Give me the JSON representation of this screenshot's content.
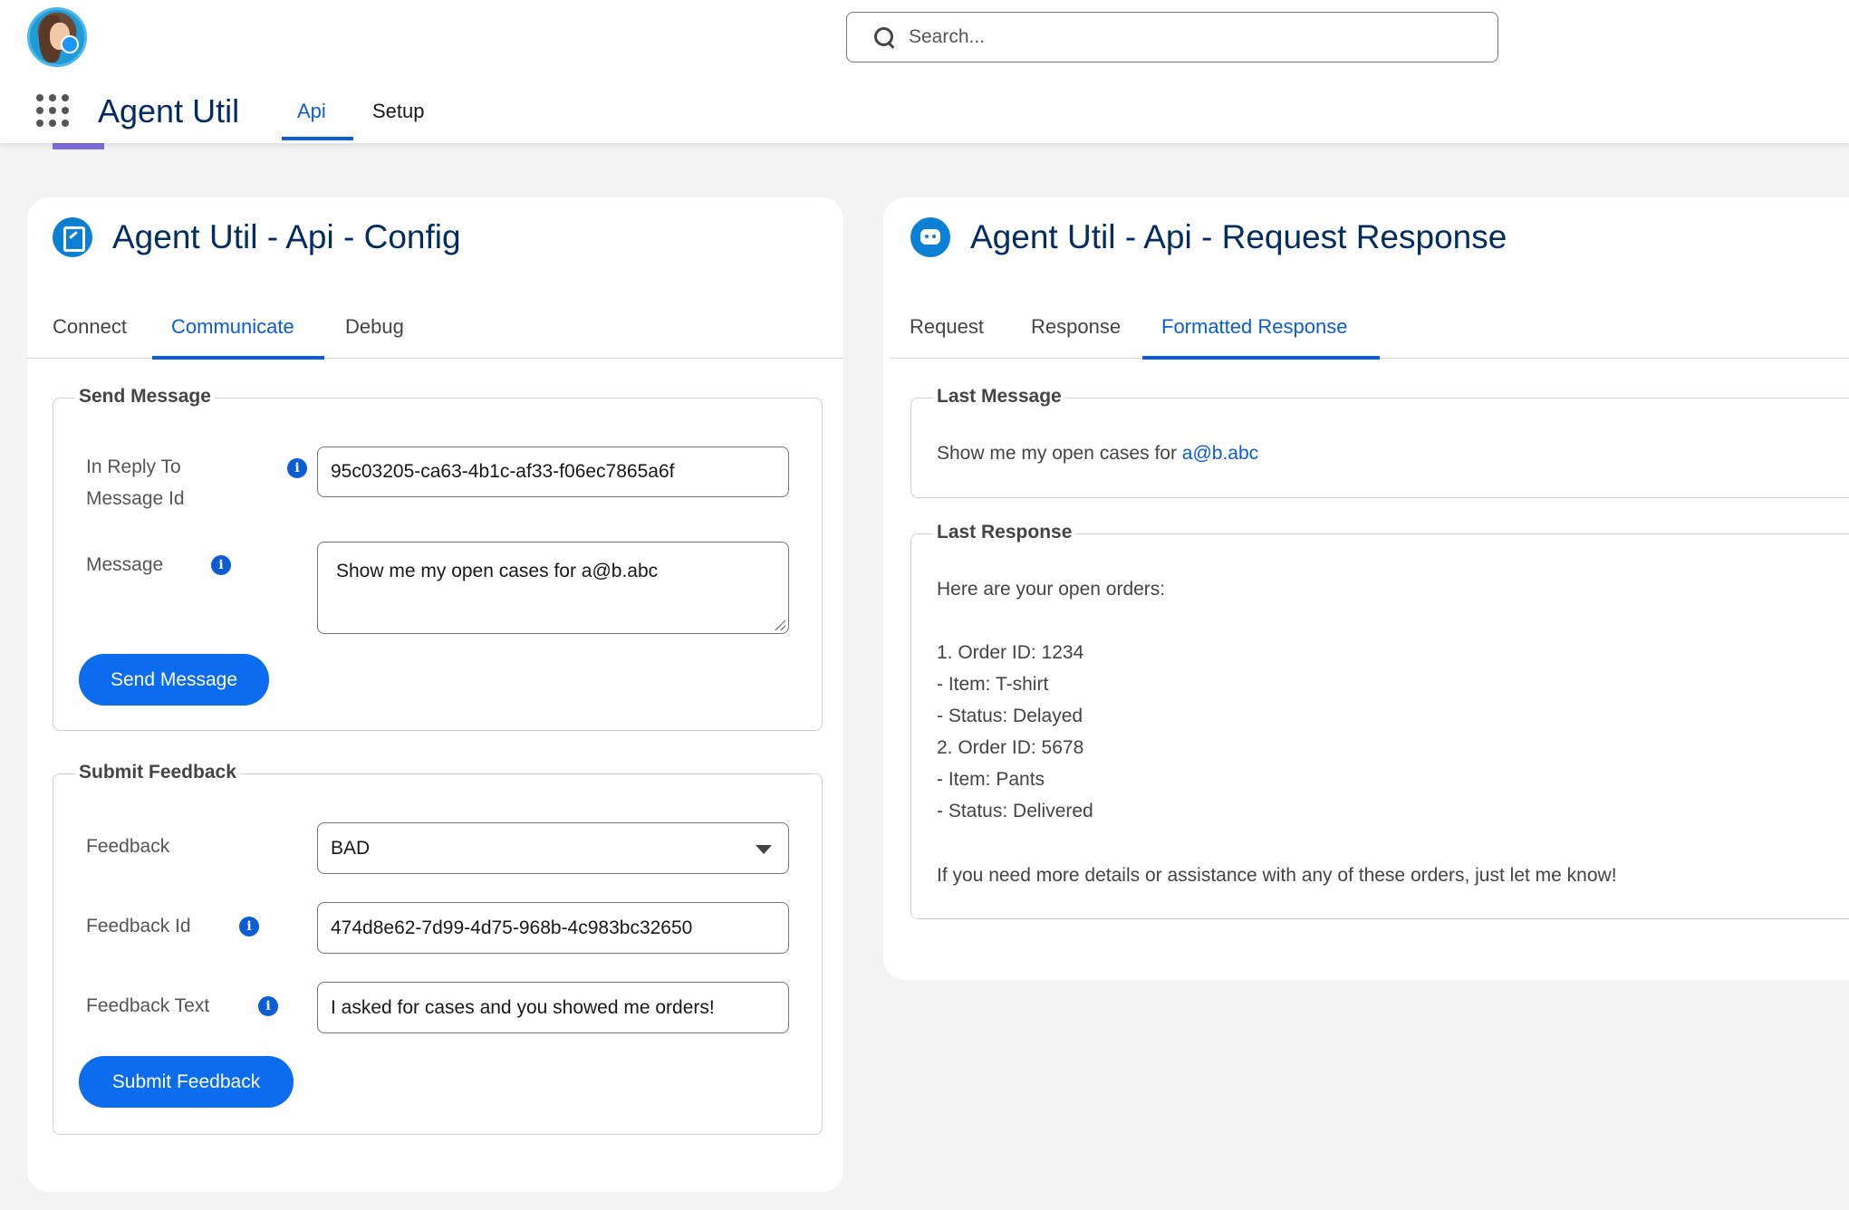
{
  "header": {
    "search_placeholder": "Search...",
    "app_name": "Agent Util",
    "nav_tabs": [
      {
        "label": "Api",
        "active": true
      },
      {
        "label": "Setup",
        "active": false
      }
    ]
  },
  "config_card": {
    "title": "Agent Util - Api - Config",
    "tabs": [
      {
        "label": "Connect",
        "active": false
      },
      {
        "label": "Communicate",
        "active": true
      },
      {
        "label": "Debug",
        "active": false
      }
    ],
    "send_message": {
      "legend": "Send Message",
      "reply_label_line1": "In Reply To",
      "reply_label_line2": "Message Id",
      "reply_value": "95c03205-ca63-4b1c-af33-f06ec7865a6f",
      "message_label": "Message",
      "message_value": "Show me my open cases for a@b.abc",
      "button_label": "Send Message"
    },
    "submit_feedback": {
      "legend": "Submit Feedback",
      "feedback_label": "Feedback",
      "feedback_value": "BAD",
      "feedback_id_label": "Feedback Id",
      "feedback_id_value": "474d8e62-7d99-4d75-968b-4c983bc32650",
      "feedback_text_label": "Feedback Text",
      "feedback_text_value": "I asked for cases and you showed me orders!",
      "button_label": "Submit Feedback"
    }
  },
  "response_card": {
    "title": "Agent Util - Api - Request Response",
    "tabs": [
      {
        "label": "Request",
        "active": false
      },
      {
        "label": "Response",
        "active": false
      },
      {
        "label": "Formatted Response",
        "active": true
      }
    ],
    "last_message": {
      "legend": "Last Message",
      "text_prefix": "Show me my open cases for ",
      "text_link": "a@b.abc"
    },
    "last_response": {
      "legend": "Last Response",
      "intro": "Here are your open orders:",
      "lines": [
        "1. Order ID: 1234",
        "- Item: T-shirt",
        "- Status: Delayed",
        "2. Order ID: 5678",
        "- Item: Pants",
        "- Status: Delivered"
      ],
      "closing": "If you need more details or assistance with any of these orders, just let me know!"
    }
  },
  "colors": {
    "brand_blue": "#0b5cd5",
    "button_blue": "#0b6cf0",
    "title_navy": "#032d60",
    "background": "#f3f3f3"
  }
}
